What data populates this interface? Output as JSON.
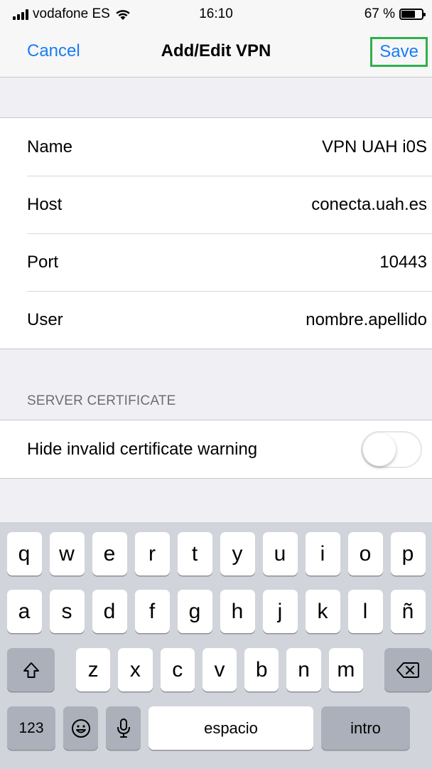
{
  "status_bar": {
    "carrier": "vodafone ES",
    "time": "16:10",
    "battery": "67 %",
    "battery_level": 0.67
  },
  "nav": {
    "cancel_label": "Cancel",
    "title": "Add/Edit VPN",
    "save_label": "Save",
    "highlight_color": "#2fb04d",
    "accent_color": "#1a7cf5"
  },
  "fields": [
    {
      "label": "Name",
      "value": "VPN UAH i0S"
    },
    {
      "label": "Host",
      "value": "conecta.uah.es"
    },
    {
      "label": "Port",
      "value": "10443"
    },
    {
      "label": "User",
      "value": "nombre.apellido"
    }
  ],
  "server_certificate": {
    "header": "SERVER CERTIFICATE",
    "toggle_label": "Hide invalid certificate warning",
    "toggle_on": false
  },
  "keyboard": {
    "row1": [
      "q",
      "w",
      "e",
      "r",
      "t",
      "y",
      "u",
      "i",
      "o",
      "p"
    ],
    "row2": [
      "a",
      "s",
      "d",
      "f",
      "g",
      "h",
      "j",
      "k",
      "l",
      "ñ"
    ],
    "row3": [
      "z",
      "x",
      "c",
      "v",
      "b",
      "n",
      "m"
    ],
    "numbers_label": "123",
    "space_label": "espacio",
    "return_label": "intro",
    "icons": [
      "shift-icon",
      "backspace-icon",
      "emoji-icon",
      "microphone-icon"
    ]
  }
}
